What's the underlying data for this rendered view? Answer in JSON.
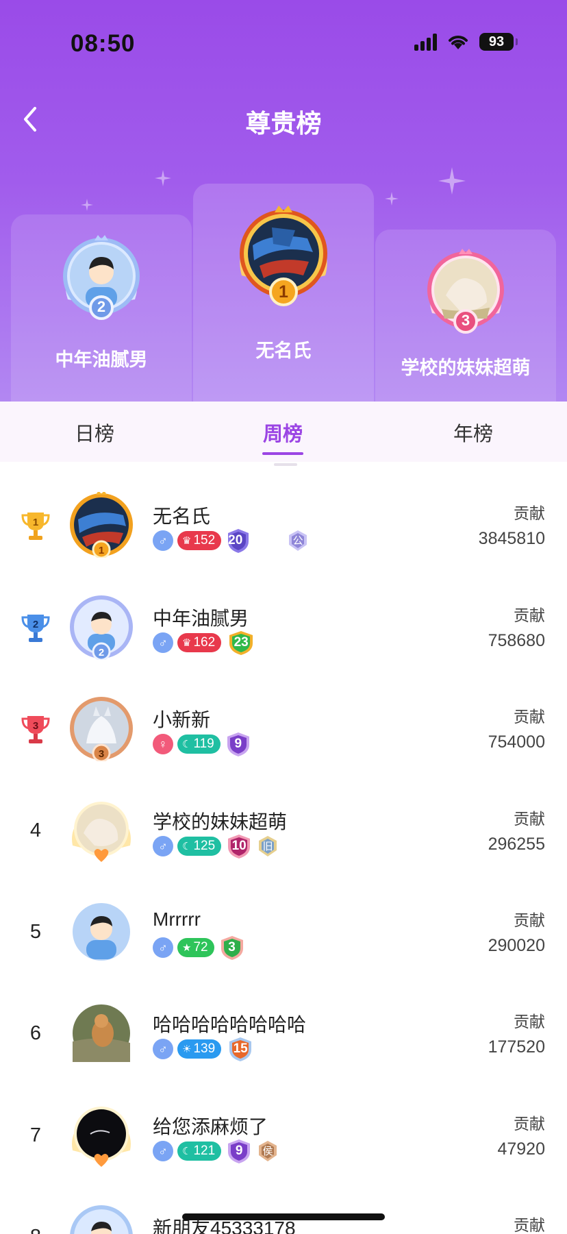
{
  "status_bar": {
    "time": "08:50",
    "battery": "93"
  },
  "header": {
    "title": "尊贵榜"
  },
  "podium": {
    "first": {
      "name": "无名氏",
      "rank": "1"
    },
    "second": {
      "name": "中年油腻男",
      "rank": "2"
    },
    "third": {
      "name": "学校的妹妹超萌",
      "rank": "3"
    }
  },
  "tabs": [
    {
      "label": "日榜",
      "active": false
    },
    {
      "label": "周榜",
      "active": true
    },
    {
      "label": "年榜",
      "active": false
    }
  ],
  "list": [
    {
      "rank": "1",
      "name": "无名氏",
      "gender": "male",
      "level": "152",
      "level_style": "crown-red",
      "badge": "20",
      "extra": "公",
      "contrib_label": "贡献",
      "contrib": "3845810"
    },
    {
      "rank": "2",
      "name": "中年油腻男",
      "gender": "male",
      "level": "162",
      "level_style": "crown-red",
      "badge": "23",
      "extra": "",
      "contrib_label": "贡献",
      "contrib": "758680"
    },
    {
      "rank": "3",
      "name": "小新新",
      "gender": "female",
      "level": "119",
      "level_style": "moon-teal",
      "badge": "9",
      "extra": "",
      "contrib_label": "贡献",
      "contrib": "754000"
    },
    {
      "rank": "4",
      "name": "学校的妹妹超萌",
      "gender": "male",
      "level": "125",
      "level_style": "moon-teal",
      "badge": "10",
      "extra": "旧",
      "contrib_label": "贡献",
      "contrib": "296255"
    },
    {
      "rank": "5",
      "name": "Mrrrrr",
      "gender": "male",
      "level": "72",
      "level_style": "star-green",
      "badge": "3",
      "extra": "",
      "contrib_label": "贡献",
      "contrib": "290020"
    },
    {
      "rank": "6",
      "name": "哈哈哈哈哈哈哈哈",
      "gender": "male",
      "level": "139",
      "level_style": "sun-blue",
      "badge": "15",
      "extra": "",
      "contrib_label": "贡献",
      "contrib": "177520"
    },
    {
      "rank": "7",
      "name": "给您添麻烦了",
      "gender": "male",
      "level": "121",
      "level_style": "moon-teal",
      "badge": "9",
      "extra": "侯",
      "contrib_label": "贡献",
      "contrib": "47920"
    },
    {
      "rank": "8",
      "name": "新朋友45333178",
      "gender": "male",
      "level": "",
      "level_style": "",
      "badge": "",
      "extra": "",
      "contrib_label": "贡献",
      "contrib": ""
    }
  ],
  "colors": {
    "accent": "#9b45e4",
    "hero_top": "#9a4be8",
    "male": "#7aa4f4",
    "female": "#f25a7a"
  }
}
